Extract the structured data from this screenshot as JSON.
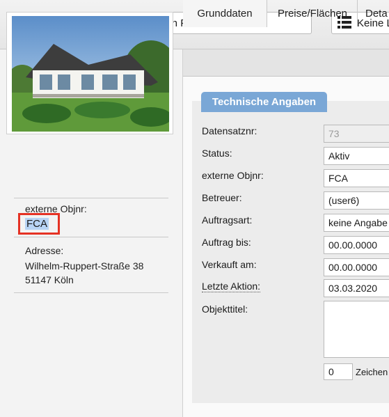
{
  "toolbar": {
    "filter_label": "Kein Filter",
    "view_label": "Keine L"
  },
  "icons": {
    "add": "plus-icon",
    "add_dropdown": "caret-down-icon",
    "save": "floppy-disk-icon",
    "back": "arrow-left-icon",
    "filter": "funnel-icon",
    "view": "list-icon"
  },
  "left_panel": {
    "objnr_label": "externe Objnr:",
    "objnr_value": "FCA",
    "address_label": "Adresse:",
    "address_street": "Wilhelm-Ruppert-Straße 38",
    "address_city": "51147 Köln"
  },
  "tabs": [
    {
      "label": "Grunddaten",
      "active": true
    },
    {
      "label": "Preise/Flächen",
      "active": false
    },
    {
      "label": "Deta",
      "active": false
    }
  ],
  "section": {
    "title": "Technische Angaben"
  },
  "form": {
    "datensatznr": {
      "label": "Datensatznr:",
      "value": "73"
    },
    "status": {
      "label": "Status:",
      "value": "Aktiv"
    },
    "objnr": {
      "label": "externe Objnr:",
      "value": "FCA"
    },
    "betreuer": {
      "label": "Betreuer:",
      "value": "(user6)"
    },
    "auftragsart": {
      "label": "Auftragsart:",
      "value": "keine Angabe"
    },
    "auftrag_bis": {
      "label": "Auftrag bis:",
      "value": "00.00.0000"
    },
    "verkauft_am": {
      "label": "Verkauft am:",
      "value": "00.00.0000"
    },
    "letzte_aktion": {
      "label": "Letzte Aktion:",
      "value": "03.03.2020"
    },
    "objekttitel": {
      "label": "Objekttitel:",
      "counter": "0",
      "counter_label": "Zeichen"
    }
  },
  "colors": {
    "accent": "#7aa7d6",
    "highlight_box": "#e53224",
    "selection": "#b8d4f5"
  }
}
